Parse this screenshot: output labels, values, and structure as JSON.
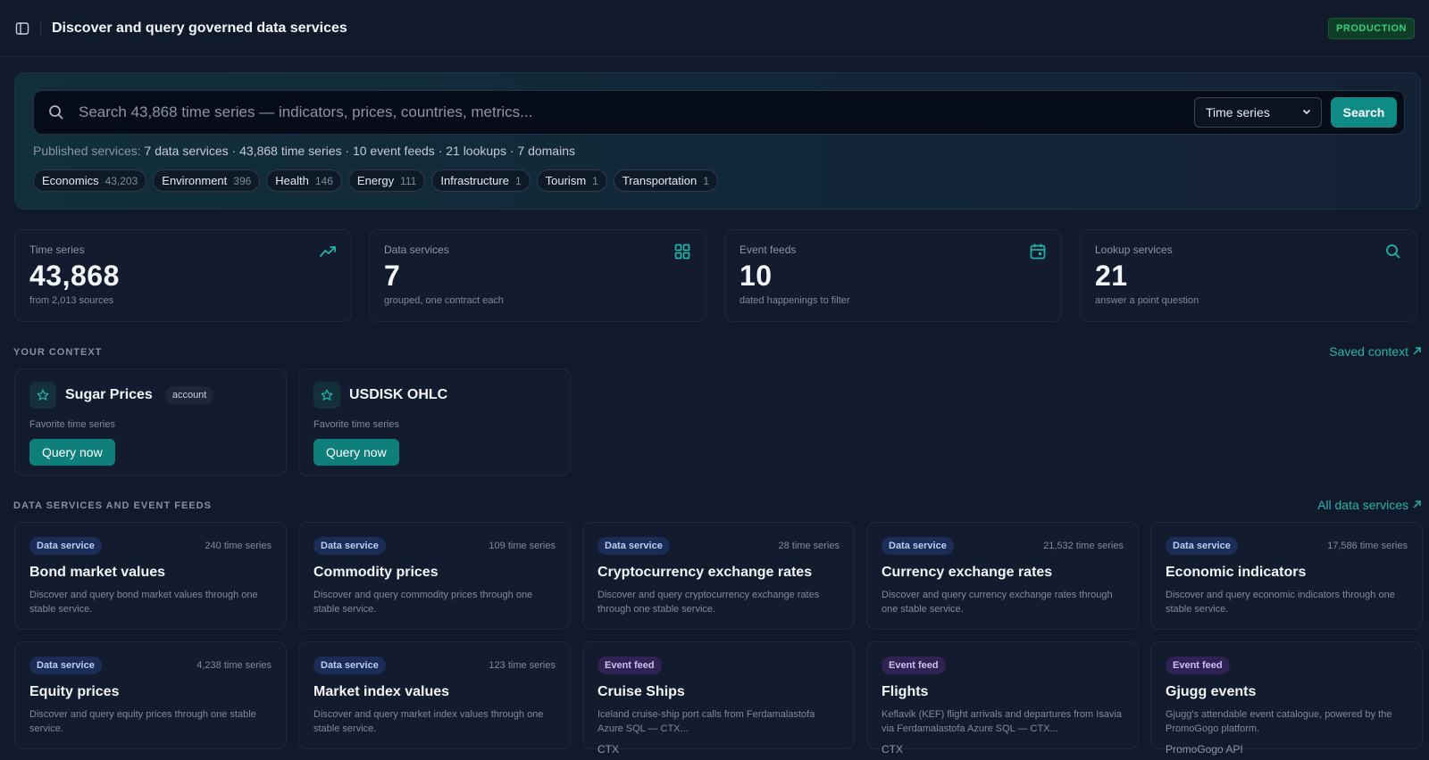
{
  "header": {
    "title": "Discover and query governed data services",
    "environment": "PRODUCTION"
  },
  "search": {
    "placeholder": "Search 43,868 time series — indicators, prices, countries, metrics...",
    "type_selected": "Time series",
    "button_label": "Search",
    "summary_label": "Published services:",
    "summary_value": "7 data services · 43,868 time series · 10 event feeds · 21 lookups · 7 domains",
    "domains": [
      {
        "name": "Economics",
        "count": "43,203"
      },
      {
        "name": "Environment",
        "count": "396"
      },
      {
        "name": "Health",
        "count": "146"
      },
      {
        "name": "Energy",
        "count": "111"
      },
      {
        "name": "Infrastructure",
        "count": "1"
      },
      {
        "name": "Tourism",
        "count": "1"
      },
      {
        "name": "Transportation",
        "count": "1"
      }
    ]
  },
  "stats": [
    {
      "label": "Time series",
      "value": "43,868",
      "sub": "from 2,013 sources",
      "icon": "trend-line-icon"
    },
    {
      "label": "Data services",
      "value": "7",
      "sub": "grouped, one contract each",
      "icon": "grid-icon"
    },
    {
      "label": "Event feeds",
      "value": "10",
      "sub": "dated happenings to filter",
      "icon": "calendar-icon"
    },
    {
      "label": "Lookup services",
      "value": "21",
      "sub": "answer a point question",
      "icon": "search-icon"
    }
  ],
  "context": {
    "title": "YOUR CONTEXT",
    "link": "Saved context",
    "items": [
      {
        "name": "Sugar Prices",
        "tag": "account",
        "sub": "Favorite time series",
        "button": "Query now"
      },
      {
        "name": "USDISK OHLC",
        "tag": "",
        "sub": "Favorite time series",
        "button": "Query now"
      }
    ]
  },
  "services": {
    "title": "DATA SERVICES AND EVENT FEEDS",
    "link": "All data services",
    "items": [
      {
        "badge": "Data service",
        "kind": "ds",
        "count": "240 time series",
        "title": "Bond market values",
        "desc": "Discover and query bond market values through one stable service.",
        "source": ""
      },
      {
        "badge": "Data service",
        "kind": "ds",
        "count": "109 time series",
        "title": "Commodity prices",
        "desc": "Discover and query commodity prices through one stable service.",
        "source": ""
      },
      {
        "badge": "Data service",
        "kind": "ds",
        "count": "28 time series",
        "title": "Cryptocurrency exchange rates",
        "desc": "Discover and query cryptocurrency exchange rates through one stable service.",
        "source": ""
      },
      {
        "badge": "Data service",
        "kind": "ds",
        "count": "21,532 time series",
        "title": "Currency exchange rates",
        "desc": "Discover and query currency exchange rates through one stable service.",
        "source": ""
      },
      {
        "badge": "Data service",
        "kind": "ds",
        "count": "17,586 time series",
        "title": "Economic indicators",
        "desc": "Discover and query economic indicators through one stable service.",
        "source": ""
      },
      {
        "badge": "Data service",
        "kind": "ds",
        "count": "4,238 time series",
        "title": "Equity prices",
        "desc": "Discover and query equity prices through one stable service.",
        "source": ""
      },
      {
        "badge": "Data service",
        "kind": "ds",
        "count": "123 time series",
        "title": "Market index values",
        "desc": "Discover and query market index values through one stable service.",
        "source": ""
      },
      {
        "badge": "Event feed",
        "kind": "ef",
        "count": "",
        "title": "Cruise Ships",
        "desc": "Iceland cruise-ship port calls from Ferdamalastofa Azure SQL — CTX...",
        "source": "CTX"
      },
      {
        "badge": "Event feed",
        "kind": "ef",
        "count": "",
        "title": "Flights",
        "desc": "Keflavik (KEF) flight arrivals and departures from Isavia via Ferdamalastofa Azure SQL — CTX...",
        "source": "CTX"
      },
      {
        "badge": "Event feed",
        "kind": "ef",
        "count": "",
        "title": "Gjugg events",
        "desc": "Gjugg's attendable event catalogue, powered by the PromoGogo platform.",
        "source": "PromoGogo API"
      }
    ]
  },
  "colors": {
    "background": "#111a2b",
    "accent": "#0f8b86",
    "link": "#24b6ad",
    "production_badge": "#35d07f"
  }
}
